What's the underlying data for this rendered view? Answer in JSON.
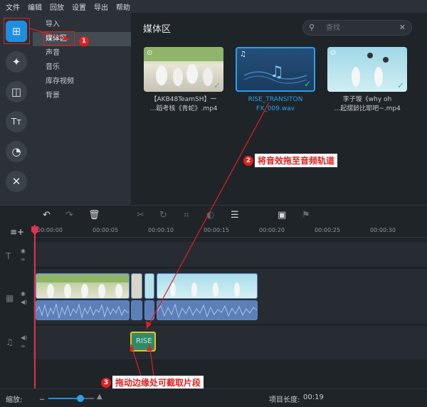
{
  "menu": [
    "文件",
    "编辑",
    "回放",
    "设置",
    "导出",
    "帮助"
  ],
  "categories": [
    "导入",
    "媒体区",
    "声音",
    "音乐",
    "库存视频",
    "背景"
  ],
  "media": {
    "title": "媒体区",
    "search_placeholder": "查找",
    "items": [
      {
        "caption": "【AKB48TeamSH】一\n…蹈考核《青蛇》.mp4",
        "selected": false
      },
      {
        "caption": "RISE_TRANSITON\nFX_009.wav",
        "selected": true
      },
      {
        "caption": "李子璇《why oh\n…起摆龄比耶吧~.mp4",
        "selected": false
      }
    ]
  },
  "ruler": [
    "00:00:00",
    "00:00:05",
    "00:00:10",
    "00:00:15",
    "00:00:20",
    "00:00:25",
    "00:00:30"
  ],
  "audio_clip_label": "RISE",
  "status": {
    "zoom_label": "缩放:",
    "zoom_level": 0.7,
    "length_label": "项目长度:",
    "length_value": "00:19"
  },
  "annotations": {
    "one": "1",
    "two": "2",
    "two_text": "将音效拖至音频轨道",
    "three": "3",
    "three_text": "拖动边缘处可截取片段"
  },
  "colors": {
    "accent": "#1e8fe0",
    "annotation": "#e02020",
    "playhead": "#e0324a",
    "check": "#2fc58c"
  }
}
